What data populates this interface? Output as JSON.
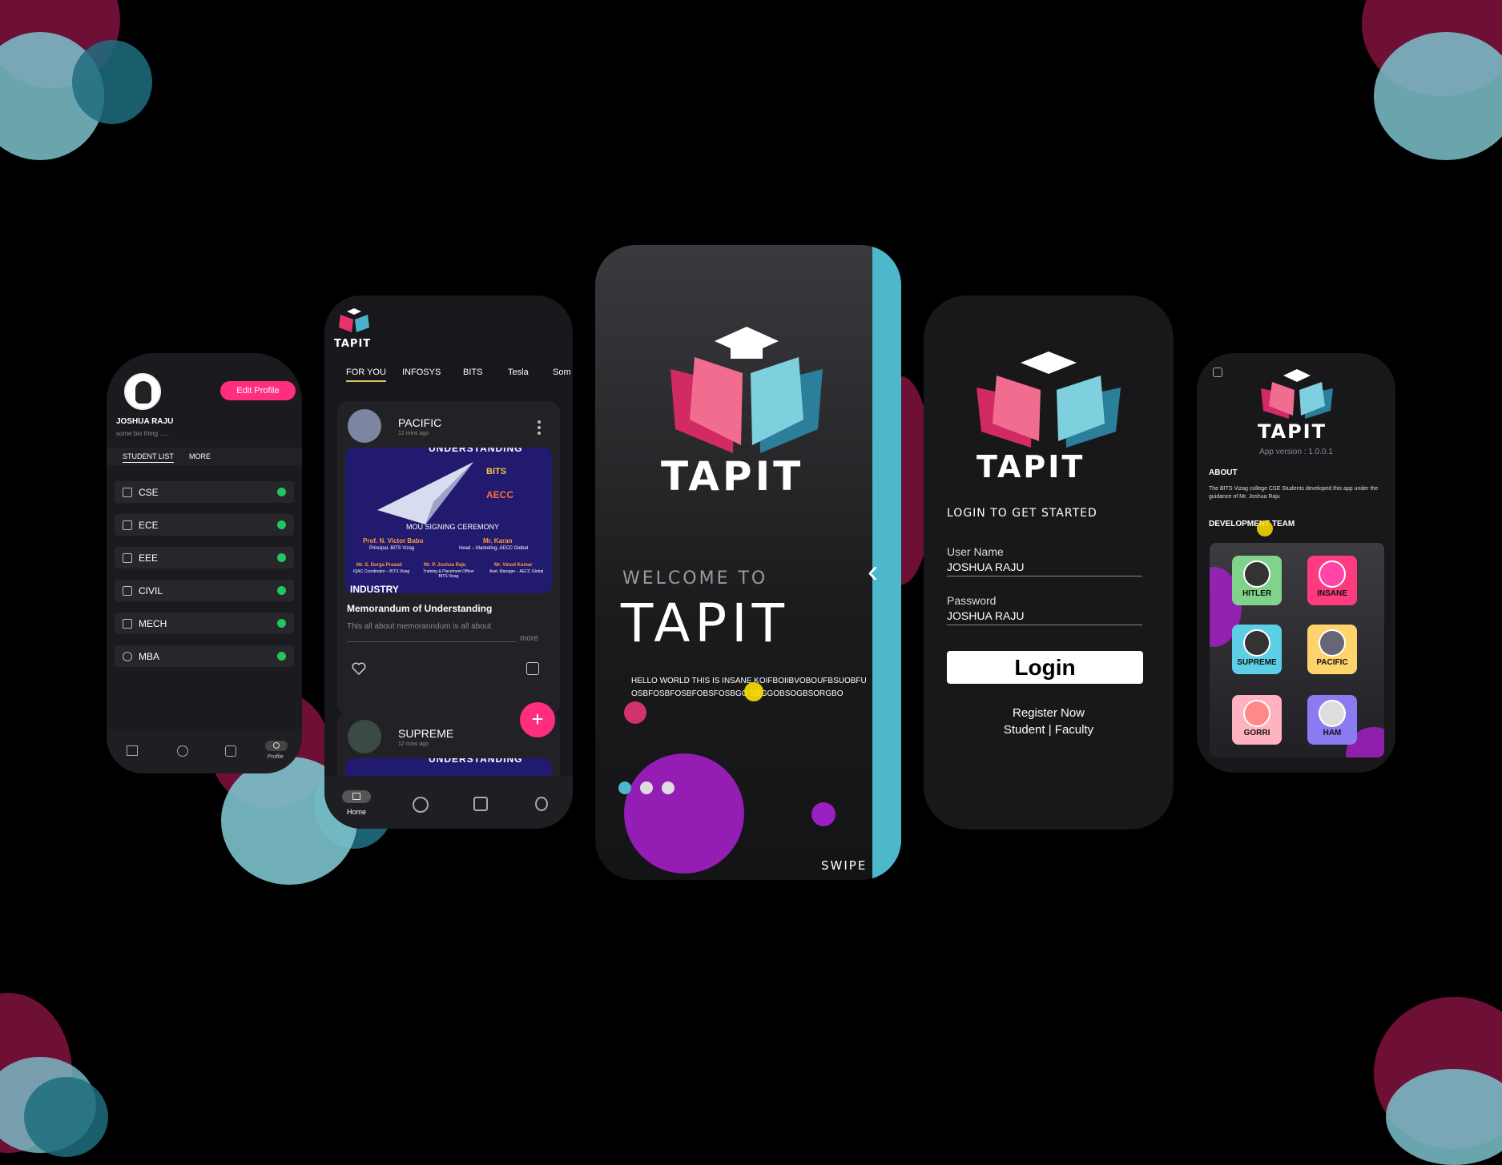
{
  "colors": {
    "accent_pink": "#ff2e7e",
    "accent_teal": "#4db8cc",
    "purple": "#a020c0",
    "bg_phone": "#18181b"
  },
  "profile_screen": {
    "name": "JOSHUA RAJU",
    "bio": "some bio thing .....",
    "edit_button": "Edit Profile",
    "tabs": [
      "STUDENT LIST",
      "MORE"
    ],
    "departments": [
      "CSE",
      "ECE",
      "EEE",
      "CIVIL",
      "MECH",
      "MBA"
    ],
    "nav_active_label": "Profile"
  },
  "feed_screen": {
    "logo": "TAPIT",
    "tabs": [
      "FOR YOU",
      "INFOSYS",
      "BITS",
      "Tesla",
      "Som"
    ],
    "post1": {
      "author": "PACIFIC",
      "time": "12 mins ago",
      "banner_top": "UNDERSTANDING",
      "banner_mid": "MOU SIGNING CEREMONY",
      "banner_bottom": "INDUSTRY",
      "badge1": "BITS",
      "badge2": "AECC",
      "person1_name": "Prof. N. Victor Babu",
      "person1_role": "Principal, BITS Vizag",
      "person2_name": "Mr. Karan",
      "person2_role": "Head – Marketing, AECC Global",
      "p3_name": "Mr. S. Durga Prasad",
      "p3_role": "IQAC Coordinator – BITS Vizag",
      "p4_name": "Mr. P. Joshua Raju",
      "p4_role": "Training & Placement Officer BITS Vizag",
      "p5_name": "Mr. Vinod Kumar",
      "p5_role": "Asst. Manager – AECC Global",
      "title": "Memorandum of Understanding",
      "desc": "This all about memoranndum is all about",
      "more": "more"
    },
    "post2": {
      "author": "SUPREME",
      "time": "12 mins ago",
      "banner_top": "UNDERSTANDING"
    },
    "fab": "+",
    "nav_home": "Home"
  },
  "welcome_screen": {
    "logo": "TAPIT",
    "welcome_to": "WELCOME TO",
    "big_title": "TAPIT",
    "body": "HELLO WORLD THIS IS INSANE KOIFBOIIBVOBOUFBSUOBFUOSBFOSBFOSBFOBSFOSBGO SBGGOBSOGBSORGBO",
    "swipe": "SWIPE",
    "back_chevron": "‹"
  },
  "login_screen": {
    "logo": "TAPIT",
    "heading": "LOGIN TO GET STARTED",
    "username_label": "User Name",
    "username_value": "JOSHUA RAJU",
    "password_label": "Password",
    "password_value": "JOSHUA RAJU",
    "login_button": "Login",
    "register": "Register Now",
    "roles": "Student | Faculty"
  },
  "about_screen": {
    "logo": "TAPIT",
    "version": "App version : 1.0.0.1",
    "about_heading": "ABOUT",
    "about_text": "The BITS Vizag college CSE Students developed this app under the guidance of Mr. Joshua Raju",
    "team_heading": "DEVELOPMENT TEAM",
    "team": [
      {
        "name": "HITLER",
        "color": "#7fd38a"
      },
      {
        "name": "INSANE",
        "color": "#ff3b7f"
      },
      {
        "name": "SUPREME",
        "color": "#5ccfe6"
      },
      {
        "name": "PACIFIC",
        "color": "#ffd36b"
      },
      {
        "name": "GORRI",
        "color": "#ffb3c1"
      },
      {
        "name": "HAM",
        "color": "#8a7cf0"
      }
    ]
  }
}
